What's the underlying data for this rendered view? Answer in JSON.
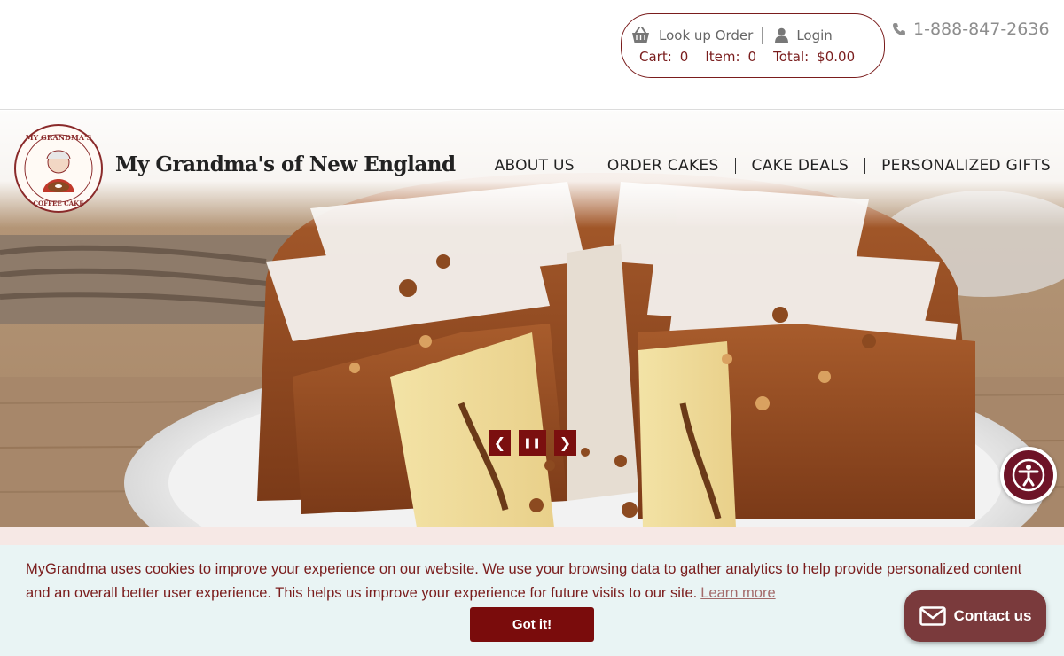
{
  "account": {
    "lookup_order": "Look up Order",
    "login": "Login",
    "cart_label": "Cart:",
    "cart_value": "0",
    "item_label": "Item:",
    "item_value": "0",
    "total_label": "Total:",
    "total_value": "$0.00"
  },
  "phone": "1-888-847-2636",
  "brand": {
    "name": "My Grandma's of New England",
    "logo_top_text": "MY GRANDMA'S",
    "logo_bottom_text": "COFFEE CAKE"
  },
  "nav": {
    "items": [
      {
        "label": "ABOUT US"
      },
      {
        "label": "ORDER CAKES"
      },
      {
        "label": "CAKE DEALS"
      },
      {
        "label": "PERSONALIZED GIFTS"
      }
    ]
  },
  "slider": {
    "prev": "❮",
    "pause": "❚❚",
    "next": "❯"
  },
  "cookie": {
    "text": "MyGrandma uses cookies to improve your experience on our website. We use your browsing data to gather analytics to help provide personalized content and an overall better user experience. This helps us improve your experience for future visits to our site.",
    "learn_more": "Learn more",
    "button": "Got it!"
  },
  "contact": {
    "label": "Contact us"
  },
  "colors": {
    "brand": "#7a0c0c",
    "accessibility": "#6e1327",
    "cookie_bg": "#e9f4f4"
  },
  "icons": [
    "basket-icon",
    "user-icon",
    "phone-icon",
    "accessibility-icon",
    "mail-icon"
  ]
}
